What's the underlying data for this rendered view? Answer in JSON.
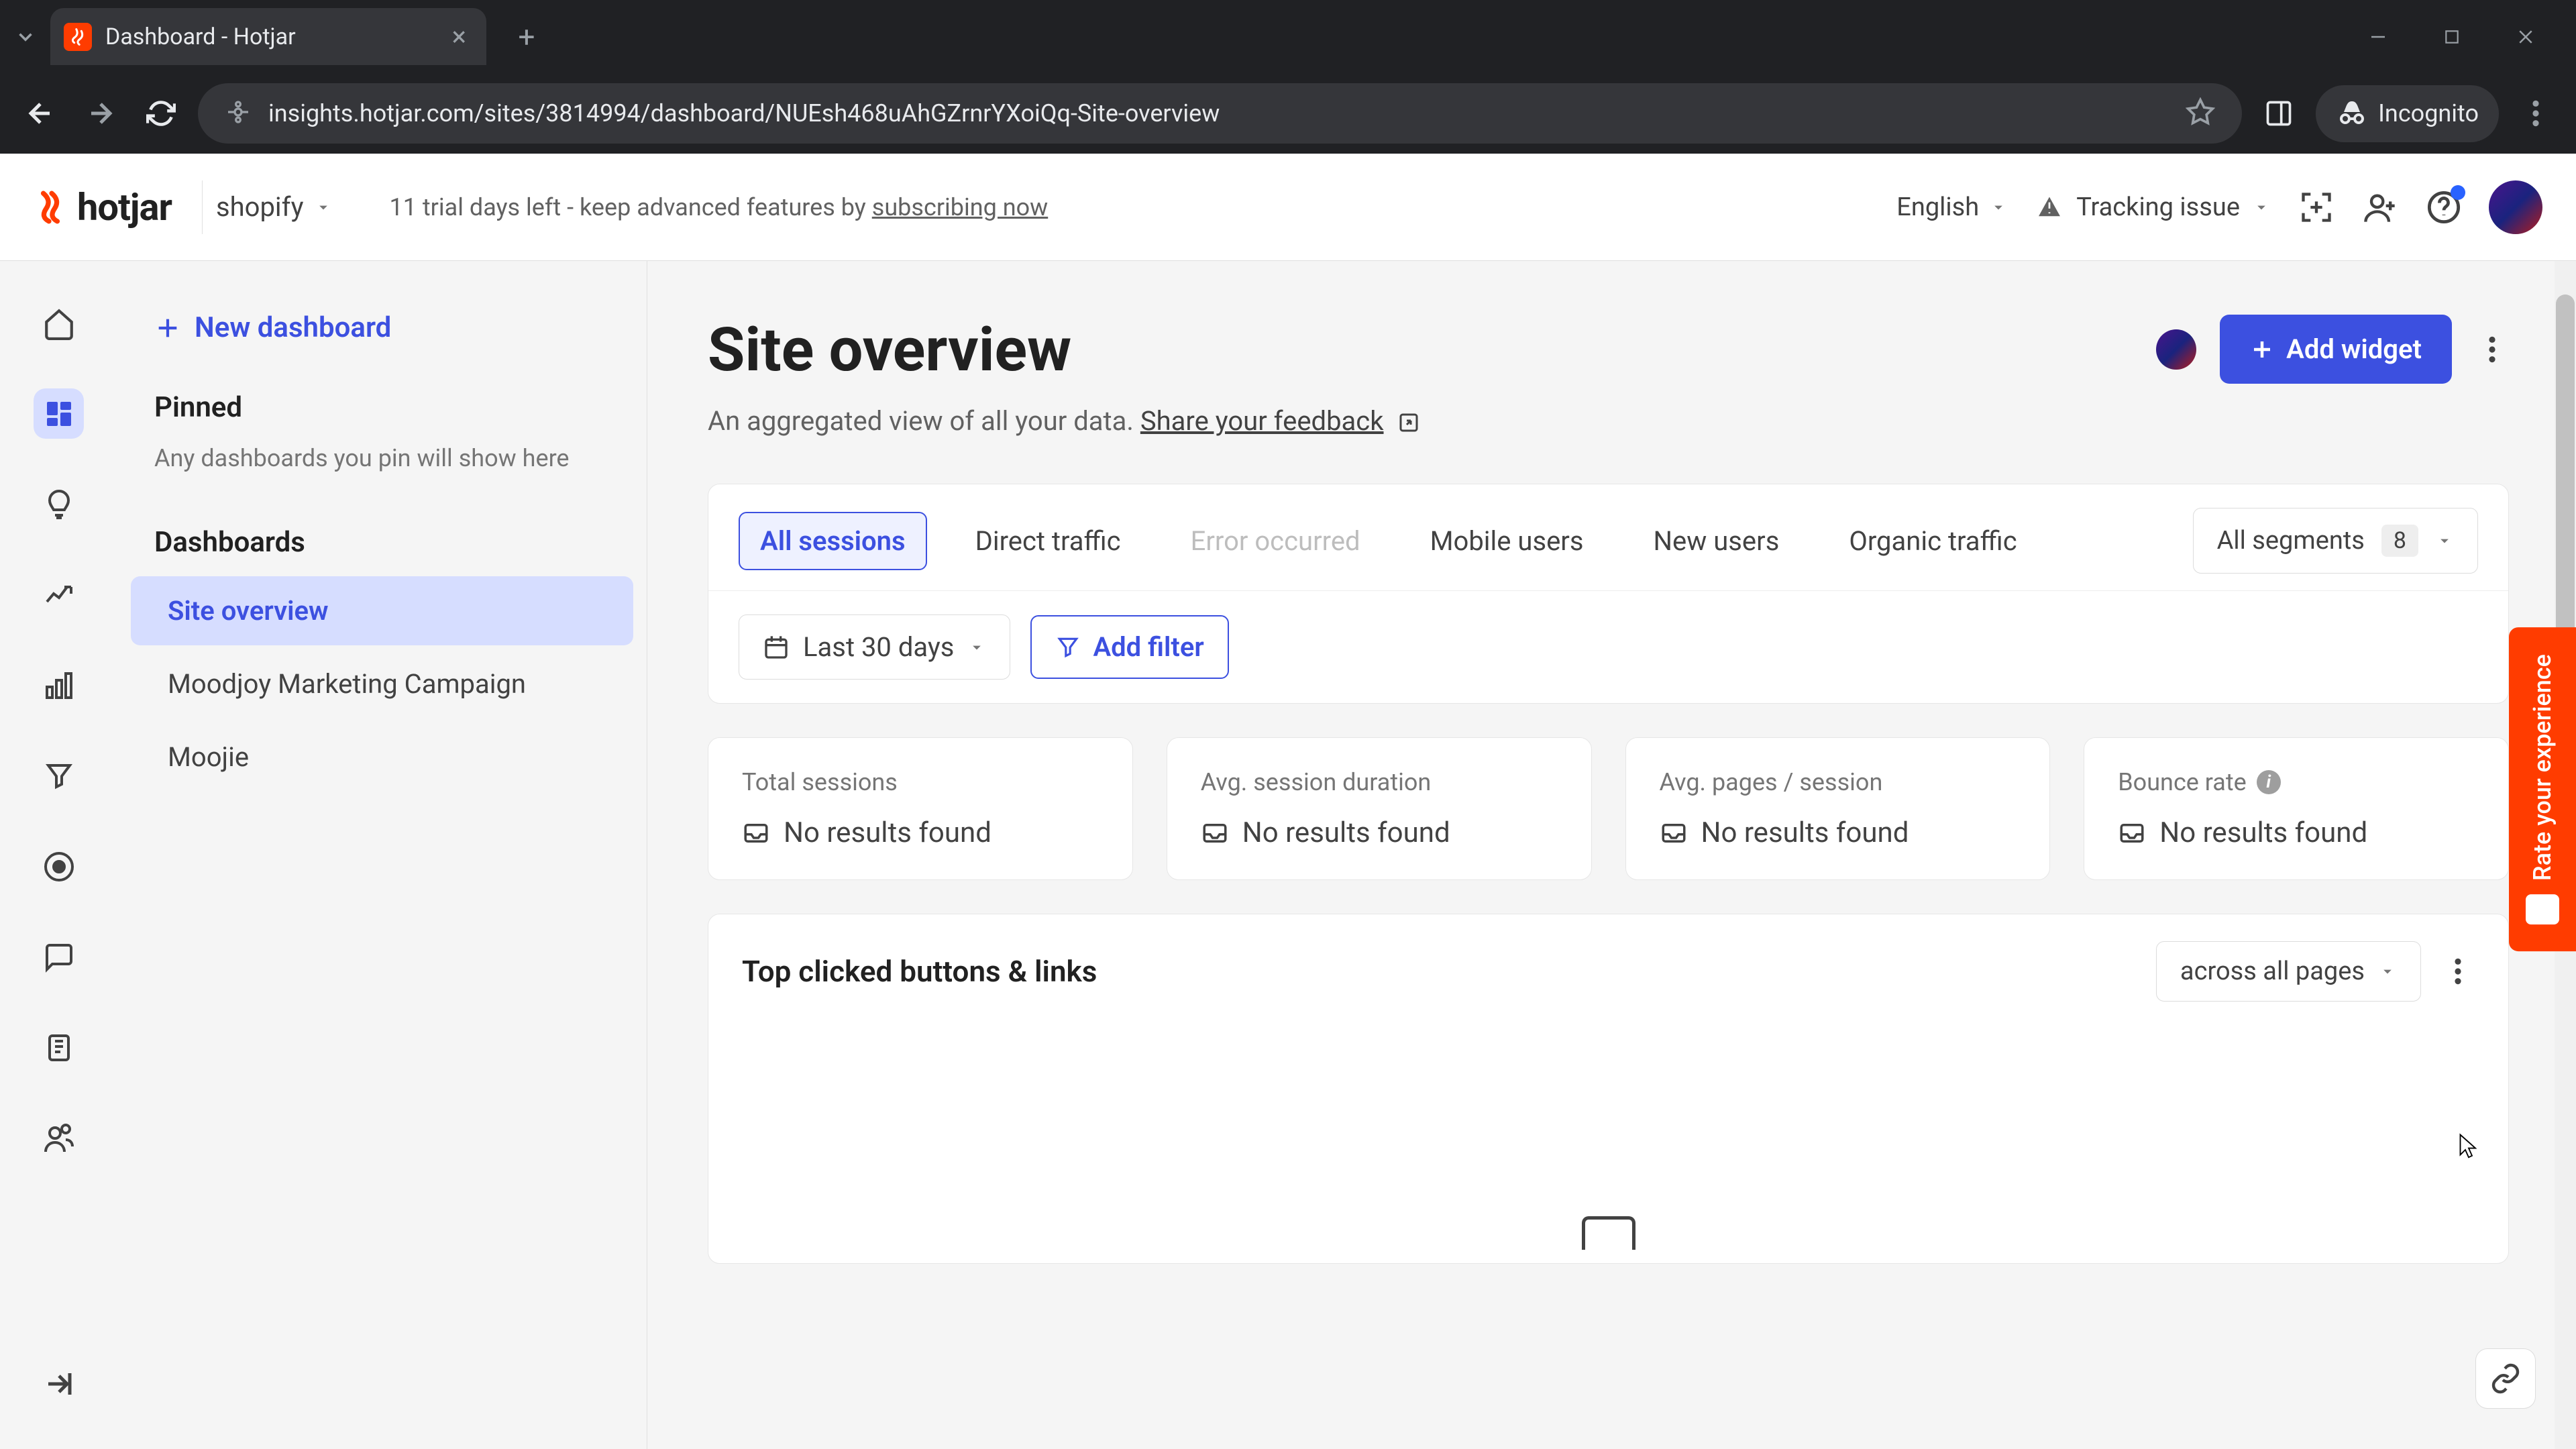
{
  "browser": {
    "tab_title": "Dashboard - Hotjar",
    "url": "insights.hotjar.com/sites/3814994/dashboard/NUEsh468uAhGZrnrYXoiQq-Site-overview",
    "incognito_label": "Incognito"
  },
  "header": {
    "logo_text": "hotjar",
    "site_name": "shopify",
    "trial_prefix": "11 trial days left - keep advanced features by ",
    "trial_link": "subscribing now",
    "language": "English",
    "tracking_label": "Tracking issue"
  },
  "sidebar": {
    "new_dashboard": "New dashboard",
    "pinned_title": "Pinned",
    "pinned_hint": "Any dashboards you pin will show here",
    "dashboards_title": "Dashboards",
    "items": [
      {
        "label": "Site overview",
        "active": true
      },
      {
        "label": "Moodjoy Marketing Campaign",
        "active": false
      },
      {
        "label": "Moojie",
        "active": false
      }
    ]
  },
  "page": {
    "title": "Site overview",
    "subtitle_text": "An aggregated view of all your data. ",
    "subtitle_link": "Share your feedback",
    "add_widget": "Add widget"
  },
  "segments": {
    "tabs": [
      {
        "label": "All sessions",
        "state": "active"
      },
      {
        "label": "Direct traffic",
        "state": "normal"
      },
      {
        "label": "Error occurred",
        "state": "disabled"
      },
      {
        "label": "Mobile users",
        "state": "normal"
      },
      {
        "label": "New users",
        "state": "normal"
      },
      {
        "label": "Organic traffic",
        "state": "normal"
      }
    ],
    "dropdown_label": "All segments",
    "dropdown_count": "8"
  },
  "filters": {
    "date_label": "Last 30 days",
    "add_filter": "Add filter"
  },
  "metrics": [
    {
      "label": "Total sessions",
      "value": "No results found",
      "info": false
    },
    {
      "label": "Avg. session duration",
      "value": "No results found",
      "info": false
    },
    {
      "label": "Avg. pages / session",
      "value": "No results found",
      "info": false
    },
    {
      "label": "Bounce rate",
      "value": "No results found",
      "info": true
    }
  ],
  "top_clicked": {
    "title": "Top clicked buttons & links",
    "scope": "across all pages"
  },
  "feedback_tab": "Rate your experience"
}
